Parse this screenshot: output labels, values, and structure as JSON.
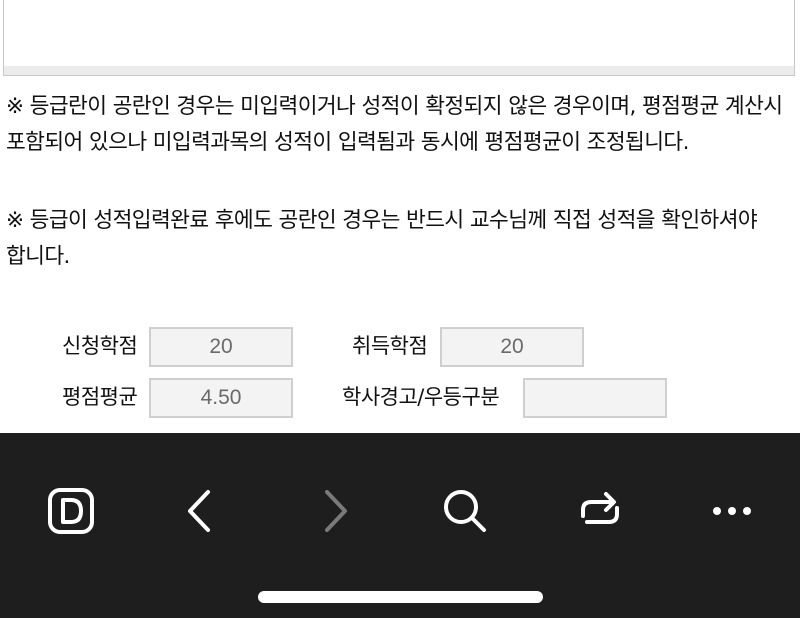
{
  "notices": [
    "※ 등급란이 공란인 경우는 미입력이거나 성적이 확정되지 않은 경우이며, 평점평균 계산시 포함되어 있으나 미입력과목의 성적이 입력됨과 동시에 평점평균이 조정됩니다.",
    "※ 등급이 성적입력완료 후에도 공란인 경우는 반드시 교수님께 직접 성적을 확인하셔야 합니다."
  ],
  "summary": {
    "requested_credits_label": "신청학점",
    "requested_credits_value": "20",
    "earned_credits_label": "취득학점",
    "earned_credits_value": "20",
    "gpa_label": "평점평균",
    "gpa_value": "4.50",
    "warning_honor_label": "학사경고/우등구분",
    "warning_honor_value": ""
  },
  "browser_nav": {
    "icons": [
      "dday-logo-icon",
      "back-icon",
      "forward-icon",
      "search-icon",
      "share-icon",
      "more-icon"
    ],
    "background": "#1e1e1e",
    "icon_color": "#ffffff",
    "disabled_color": "#7a7a7a"
  }
}
